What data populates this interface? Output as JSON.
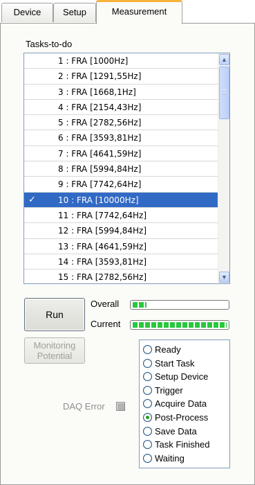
{
  "tabs": [
    {
      "label": "Device",
      "active": false
    },
    {
      "label": "Setup",
      "active": false
    },
    {
      "label": "Measurement",
      "active": true
    }
  ],
  "tasks": {
    "label": "Tasks-to-do",
    "items": [
      "1 : FRA [1000Hz]",
      "2 : FRA [1291,55Hz]",
      "3 : FRA [1668,1Hz]",
      "4 : FRA [2154,43Hz]",
      "5 : FRA [2782,56Hz]",
      "6 : FRA [3593,81Hz]",
      "7 : FRA [4641,59Hz]",
      "8 : FRA [5994,84Hz]",
      "9 : FRA [7742,64Hz]",
      "10 : FRA [10000Hz]",
      "11 : FRA [7742,64Hz]",
      "12 : FRA [5994,84Hz]",
      "13 : FRA [4641,59Hz]",
      "14 : FRA [3593,81Hz]",
      "15 : FRA [2782,56Hz]"
    ],
    "selected_index": 9,
    "checkmark": "✓"
  },
  "controls": {
    "run_label": "Run",
    "overall_label": "Overall",
    "current_label": "Current",
    "overall_progress": 0.15,
    "current_progress": 1.0,
    "monitoring_line1": "Monitoring",
    "monitoring_line2": "Potential",
    "daq_error_label": "DAQ Error"
  },
  "status": {
    "items": [
      "Ready",
      "Start Task",
      "Setup Device",
      "Trigger",
      "Acquire Data",
      "Post-Process",
      "Save Data",
      "Task Finished",
      "Waiting"
    ],
    "active_index": 5
  },
  "colors": {
    "selection": "#316ac5",
    "progress": "#28c83c",
    "active_tab_accent": "#f7b33c"
  },
  "icons": {
    "scroll_up": "▲",
    "scroll_down": "▼"
  }
}
